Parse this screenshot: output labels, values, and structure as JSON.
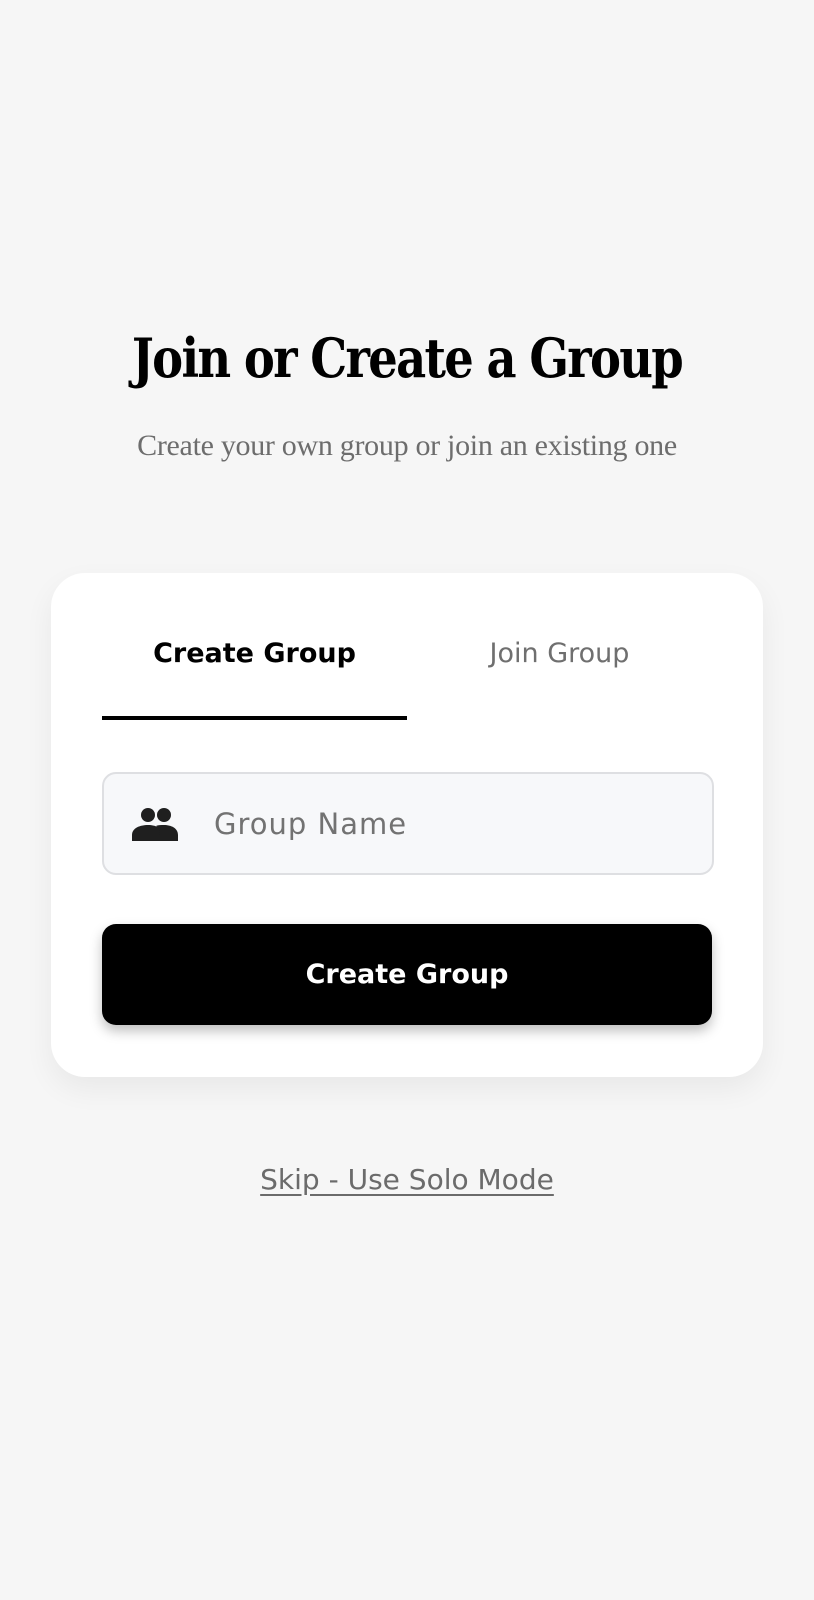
{
  "header": {
    "title": "Join or Create a Group",
    "subtitle": "Create your own group or join an existing one"
  },
  "tabs": [
    {
      "label": "Create Group",
      "active": true
    },
    {
      "label": "Join Group",
      "active": false
    }
  ],
  "group_name_input": {
    "icon": "group-icon",
    "placeholder": "Group Name",
    "value": ""
  },
  "primary_button": {
    "label": "Create Group"
  },
  "skip_link": {
    "label": "Skip - Use Solo Mode"
  },
  "colors": {
    "background": "#f6f6f6",
    "card": "#ffffff",
    "primary": "#000000",
    "muted_text": "#6d6d6d",
    "input_background": "#f7f8fa",
    "input_border": "#dedfe2"
  }
}
